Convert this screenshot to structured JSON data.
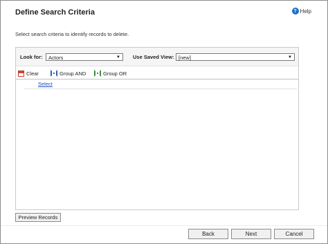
{
  "dialog": {
    "title": "Define Search Criteria",
    "help_label": "Help",
    "instruction": "Select search criteria to identify records to delete."
  },
  "lookfor": {
    "label": "Look for:",
    "value": "Actors",
    "saved_view_label": "Use Saved View:",
    "saved_view_value": "[new]"
  },
  "toolbar": {
    "clear_label": "Clear",
    "group_and_label": "Group AND",
    "group_or_label": "Group OR"
  },
  "criteria": {
    "select_link": "Select"
  },
  "buttons": {
    "preview_label": "Preview Records",
    "back_label": "Back",
    "next_label": "Next",
    "cancel_label": "Cancel"
  },
  "icons": {
    "help": "help-icon",
    "clear": "clear-icon",
    "group_and": "group-and-icon",
    "group_or": "group-or-icon",
    "dropdown": "chevron-down-icon"
  }
}
